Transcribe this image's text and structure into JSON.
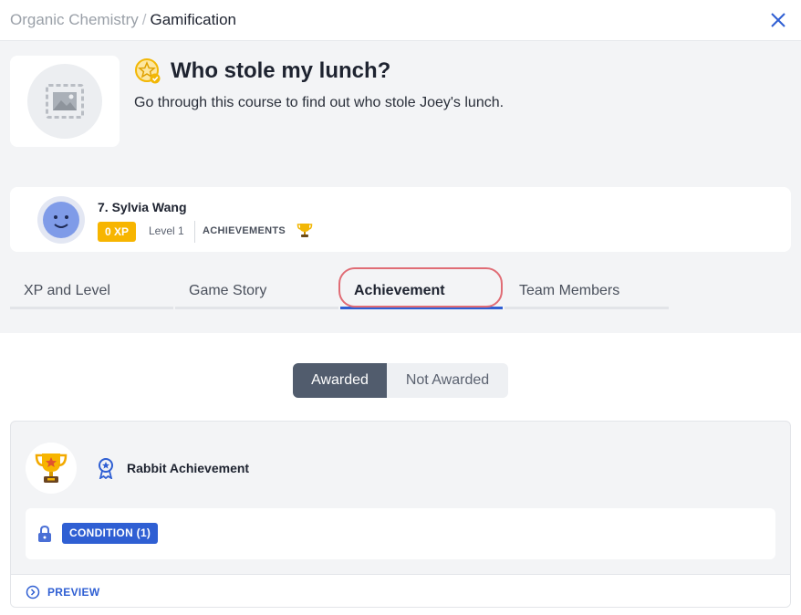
{
  "breadcrumb": {
    "parent": "Organic Chemistry",
    "separator": "/",
    "current": "Gamification"
  },
  "header": {
    "close_icon": "close-icon"
  },
  "game": {
    "icon": "badge-star-icon",
    "title": "Who stole my lunch?",
    "description": "Go through this course to find out who stole Joey's lunch.",
    "thumbnail_icon": "image-placeholder-icon"
  },
  "player": {
    "name": "7. Sylvia Wang",
    "xp": "0 XP",
    "level": "Level 1",
    "achievements_label": "ACHIEVEMENTS",
    "achievements_icon": "trophy-icon",
    "avatar_icon": "smiley-avatar-icon"
  },
  "tabs": [
    {
      "label": "XP and Level",
      "active": false
    },
    {
      "label": "Game Story",
      "active": false
    },
    {
      "label": "Achievement",
      "active": true
    },
    {
      "label": "Team Members",
      "active": false
    }
  ],
  "filter": {
    "options": [
      {
        "label": "Awarded",
        "active": true
      },
      {
        "label": "Not Awarded",
        "active": false
      }
    ]
  },
  "achievements": [
    {
      "icon": "trophy-icon",
      "type_icon": "ribbon-medal-icon",
      "name": "Rabbit Achievement",
      "condition_label": "CONDITION (1)",
      "condition_icon": "lock-icon",
      "preview_label": "PREVIEW",
      "preview_icon": "chevron-circle-icon"
    }
  ],
  "colors": {
    "accent": "#2f5fd3",
    "xp_badge": "#f7b500",
    "highlight_ring": "#e06c75",
    "segmented_active": "#515c6d",
    "panel_bg": "#f3f4f6"
  }
}
